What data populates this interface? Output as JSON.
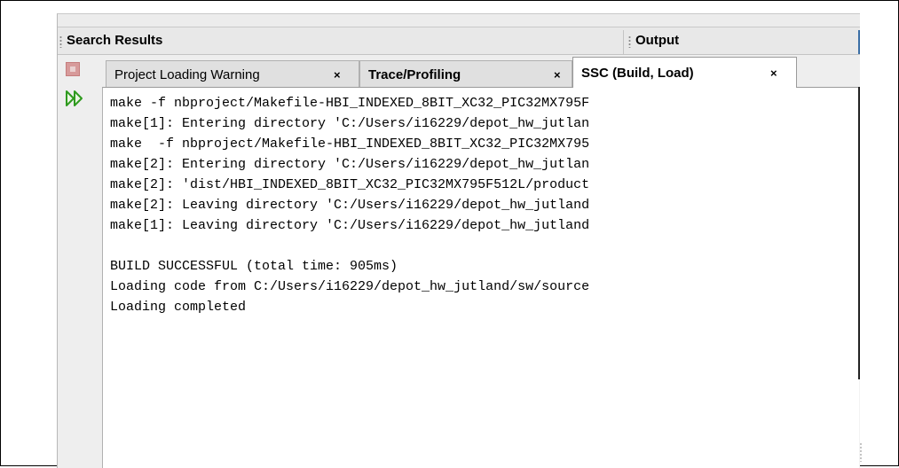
{
  "panels": {
    "search_results": "Search Results",
    "output": "Output"
  },
  "tabs": [
    {
      "label": "Project Loading Warning",
      "close": "×"
    },
    {
      "label": "Trace/Profiling",
      "close": "×"
    },
    {
      "label": "SSC (Build, Load)",
      "close": "×"
    }
  ],
  "console_lines": [
    "make -f nbproject/Makefile-HBI_INDEXED_8BIT_XC32_PIC32MX795F",
    "make[1]: Entering directory 'C:/Users/i16229/depot_hw_jutlan",
    "make  -f nbproject/Makefile-HBI_INDEXED_8BIT_XC32_PIC32MX795",
    "make[2]: Entering directory 'C:/Users/i16229/depot_hw_jutlan",
    "make[2]: 'dist/HBI_INDEXED_8BIT_XC32_PIC32MX795F512L/product",
    "make[2]: Leaving directory 'C:/Users/i16229/depot_hw_jutland",
    "make[1]: Leaving directory 'C:/Users/i16229/depot_hw_jutland",
    "",
    "BUILD SUCCESSFUL (total time: 905ms)",
    "Loading code from C:/Users/i16229/depot_hw_jutland/sw/source",
    "Loading completed"
  ],
  "icons": {
    "stop": "stop-icon",
    "rerun": "rerun-icon"
  },
  "colors": {
    "rerun_green": "#2e9a1e",
    "stop_red": "#d79a9a"
  }
}
